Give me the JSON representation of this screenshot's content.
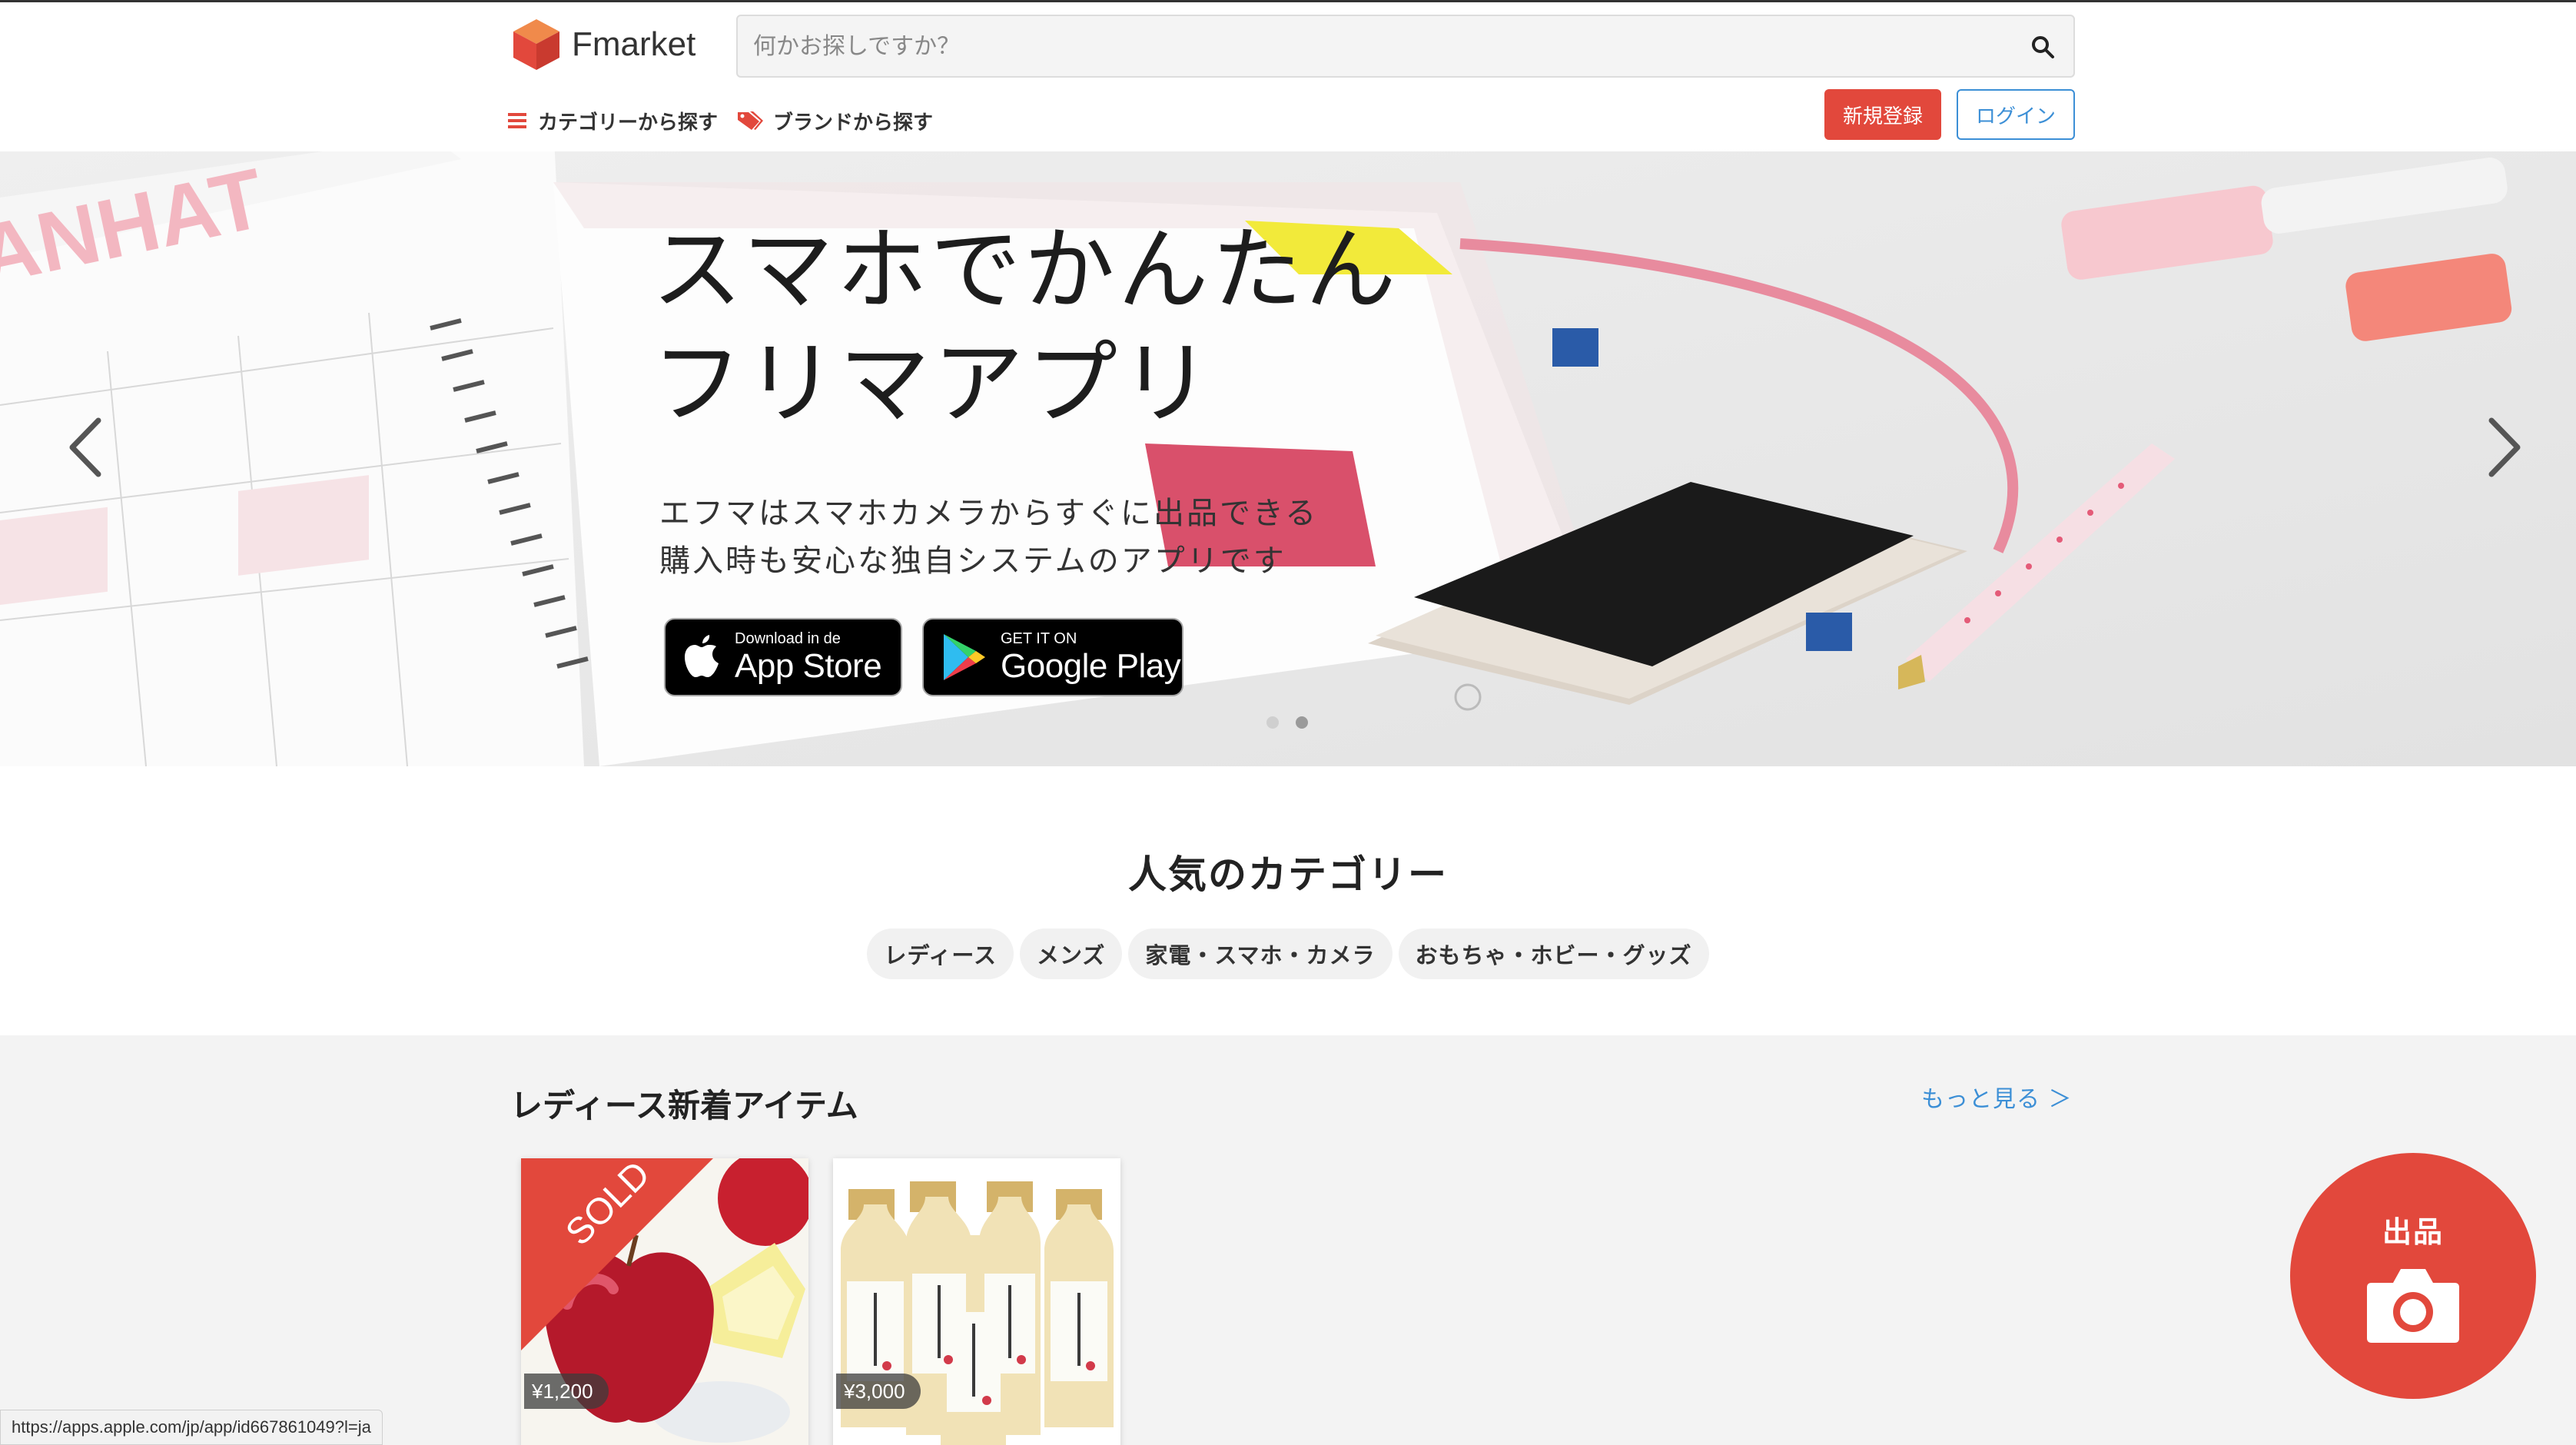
{
  "header": {
    "logo_text": "Fmarket",
    "search_placeholder": "何かお探しですか？",
    "nav_category": "カテゴリーから探す",
    "nav_brand": "ブランドから探す",
    "register_label": "新規登録",
    "login_label": "ログイン"
  },
  "hero": {
    "title_line1": "スマホでかんたん",
    "title_line2": "フリマアプリ",
    "sub_line1": "エフマはスマホカメラからすぐに出品できる",
    "sub_line2": "購入時も安心な独自システムのアプリです",
    "app_store_small": "Download in de",
    "app_store_big": "App Store",
    "google_small": "GET IT ON",
    "google_big": "Google Play",
    "slides": 2,
    "active_slide": 2
  },
  "popular": {
    "title": "人気のカテゴリー",
    "categories": [
      "レディース",
      "メンズ",
      "家電・スマホ・カメラ",
      "おもちゃ・ホビー・グッズ"
    ]
  },
  "new_items": {
    "title": "レディース新着アイテム",
    "more_label": "もっと見る ＞",
    "items": [
      {
        "price": "¥1,200",
        "sold_label": "SOLD"
      },
      {
        "price": "¥3,000"
      }
    ]
  },
  "fab": {
    "label": "出品"
  },
  "status_bar": {
    "url": "https://apps.apple.com/jp/app/id667861049?l=ja"
  },
  "colors": {
    "accent_red": "#e2483c",
    "link_blue": "#3c8fd6",
    "section_gray": "#f3f3f3"
  }
}
